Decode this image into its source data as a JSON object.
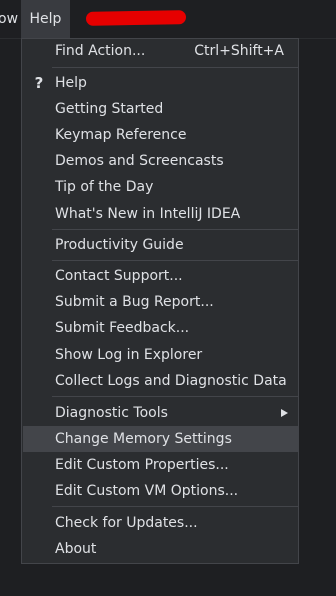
{
  "menubar": {
    "prev_item": "ow",
    "help": "Help"
  },
  "menu": {
    "find_action": {
      "label": "Find Action...",
      "shortcut": "Ctrl+Shift+A"
    },
    "help": "Help",
    "getting_started": "Getting Started",
    "keymap_reference": "Keymap Reference",
    "demos": "Demos and Screencasts",
    "tip_of_day": "Tip of the Day",
    "whats_new": "What's New in IntelliJ IDEA",
    "productivity_guide": "Productivity Guide",
    "contact_support": "Contact Support...",
    "submit_bug": "Submit a Bug Report...",
    "submit_feedback": "Submit Feedback...",
    "show_log": "Show Log in Explorer",
    "collect_logs": "Collect Logs and Diagnostic Data",
    "diagnostic_tools": "Diagnostic Tools",
    "change_memory": "Change Memory Settings",
    "edit_custom_props": "Edit Custom Properties...",
    "edit_vm_options": "Edit Custom VM Options...",
    "check_updates": "Check for Updates...",
    "about": "About"
  },
  "icons": {
    "help_icon": "question-mark",
    "submenu_icon": "chevron-right"
  },
  "colors": {
    "menu_bg": "#2b2d30",
    "selected_bg": "#43454a",
    "redaction": "#e60000"
  }
}
